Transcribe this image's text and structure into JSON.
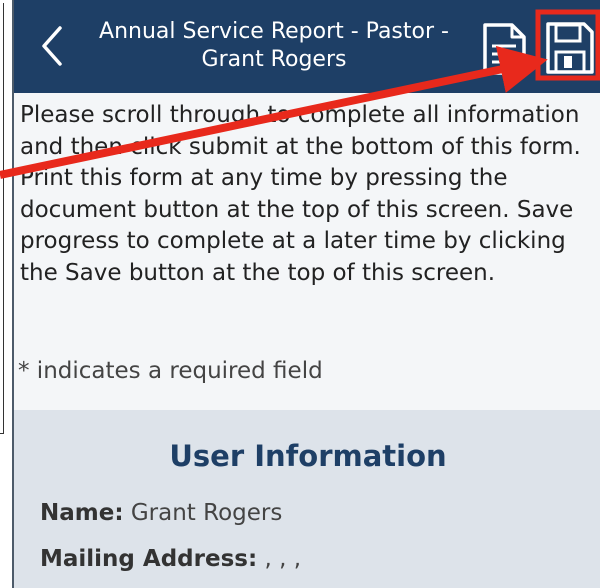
{
  "header": {
    "title_line1": "Annual Service Report - Pastor -",
    "title_line2": "Grant Rogers",
    "background": "#1e3f66",
    "back_icon": "chevron-left-icon",
    "document_icon": "document-icon",
    "save_icon": "floppy-disk-icon"
  },
  "instructions": {
    "text": "Please scroll through to complete all information and then click submit at the bottom of this form.  Print this form at any time by pressing the document button at the top of this screen. Save progress to complete at a later time by clicking the Save button at the top of this screen."
  },
  "required_note": "* indicates a required field",
  "user_information": {
    "title": "User Information",
    "name_label": "Name:",
    "name_value": "Grant Rogers",
    "mailing_label": "Mailing Address:",
    "mailing_value": ", , ,"
  },
  "annotation": {
    "arrow_color": "#e8291c"
  }
}
